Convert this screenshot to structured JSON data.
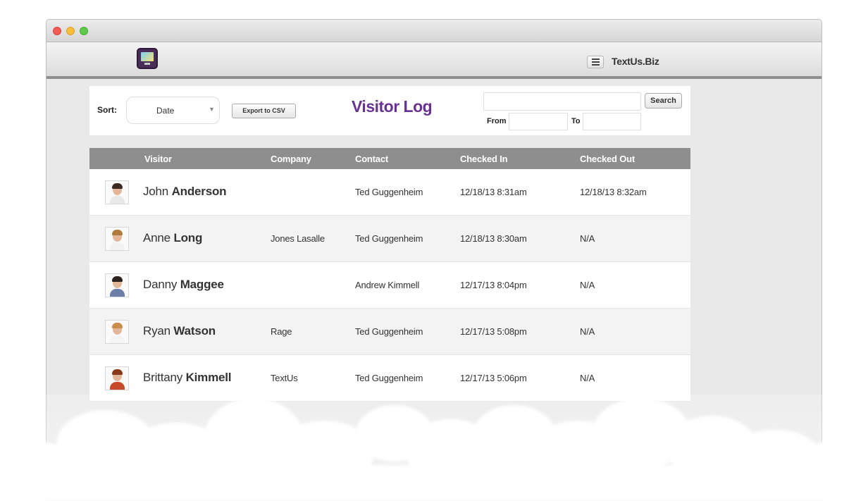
{
  "app": {
    "brand": "TextUs.Biz"
  },
  "toolbar": {
    "sort_label": "Sort:",
    "sort_value": "Date",
    "export_label": "Export to CSV",
    "title": "Visitor Log",
    "search_value": "",
    "search_label": "Search",
    "from_label": "From",
    "from_value": "",
    "to_label": "To",
    "to_value": ""
  },
  "table": {
    "headers": [
      "Visitor",
      "Company",
      "Contact",
      "Checked In",
      "Checked Out"
    ],
    "rows": [
      {
        "first": "John",
        "last": "Anderson",
        "company": "",
        "contact": "Ted Guggenheim",
        "checked_in": "12/18/13 8:31am",
        "checked_out": "12/18/13 8:32am"
      },
      {
        "first": "Anne",
        "last": "Long",
        "company": "Jones Lasalle",
        "contact": "Ted Guggenheim",
        "checked_in": "12/18/13 8:30am",
        "checked_out": "N/A"
      },
      {
        "first": "Danny",
        "last": "Maggee",
        "company": "",
        "contact": "Andrew Kimmell",
        "checked_in": "12/17/13 8:04pm",
        "checked_out": "N/A"
      },
      {
        "first": "Ryan",
        "last": "Watson",
        "company": "Rage",
        "contact": "Ted Guggenheim",
        "checked_in": "12/17/13 5:08pm",
        "checked_out": "N/A"
      },
      {
        "first": "Brittany",
        "last": "Kimmell",
        "company": "TextUs",
        "contact": "Ted Guggenheim",
        "checked_in": "12/17/13 5:06pm",
        "checked_out": "N/A"
      }
    ]
  },
  "colors": {
    "title": "#6a3290",
    "header_bg": "#8e8e8e",
    "window_bg": "#e9e9e9"
  }
}
